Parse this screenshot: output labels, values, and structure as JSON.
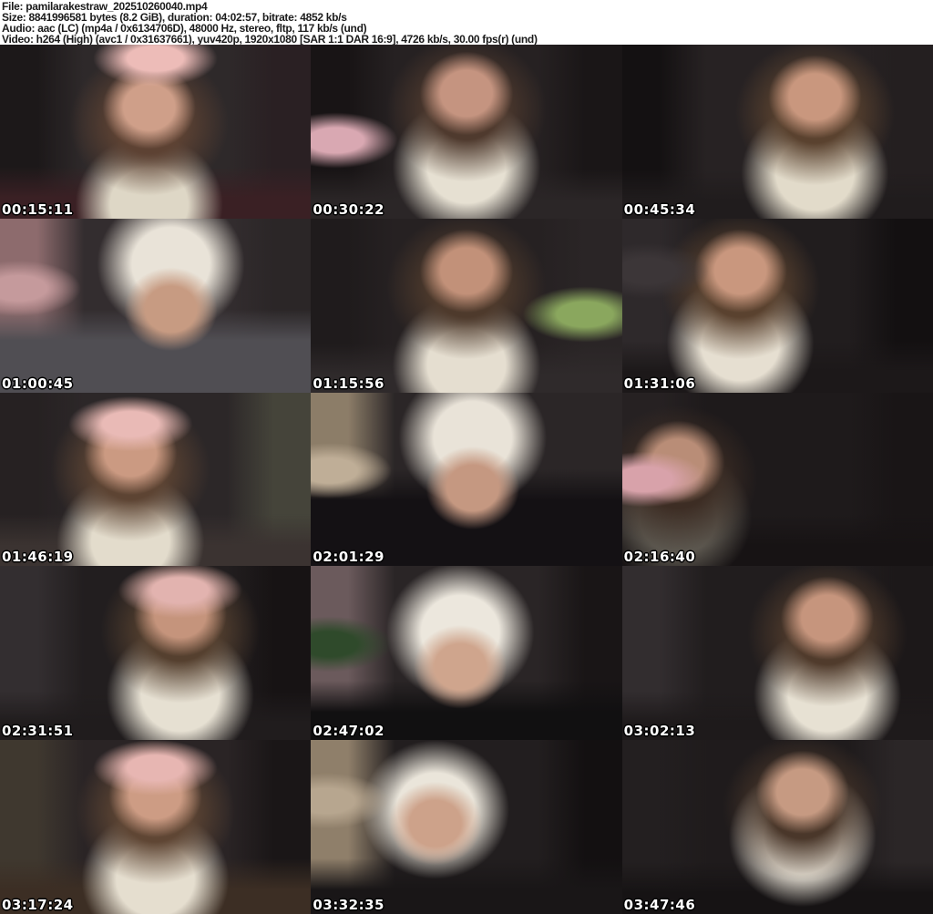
{
  "theme": {
    "header_background": "#ffffff",
    "header_text_color": "#1b1b1b",
    "timestamp_text_color": "#ffffff",
    "timestamp_outline_color": "#000000"
  },
  "header": {
    "lines": [
      "File: pamilarakestraw_202510260040.mp4",
      "Size: 8841996581 bytes (8.2 GiB), duration: 04:02:57, bitrate: 4852 kb/s",
      "Audio: aac (LC) (mp4a / 0x6134706D), 48000 Hz, stereo, fltp, 117 kb/s (und)",
      "Video: h264 (High) (avc1 / 0x31637661), yuv420p, 1920x1080 [SAR 1:1 DAR 16:9], 4726 kb/s, 30.00 fps(r) (und)"
    ]
  },
  "thumbnails": [
    {
      "timestamp": "00:15:11",
      "fx": "48%",
      "sy": "36%",
      "hair": "#5d4233",
      "skin": "#cf9f89",
      "top": "#ded7c6",
      "ty": "92%",
      "accent": "#edbcb8",
      "ax": "50%",
      "ay": "8%",
      "edgeL": "#1c1819",
      "edgeR": "#2a2023",
      "bottom": "#3a2024",
      "bh": "12%",
      "bg": "#2e292a"
    },
    {
      "timestamp": "00:30:22",
      "fx": "50%",
      "sy": "28%",
      "hair": "#4f3a2e",
      "skin": "#c59480",
      "top": "#e6e0d2",
      "ty": "70%",
      "accent": "#d9a8b2",
      "ax": "8%",
      "ay": "55%",
      "edgeL": "#181415",
      "edgeR": "#1a1617",
      "bottom": "#2b2627",
      "bh": "10%",
      "bg": "#262122"
    },
    {
      "timestamp": "00:45:34",
      "fx": "62%",
      "sy": "30%",
      "hair": "#5a422f",
      "skin": "#c9977e",
      "top": "#e2dbca",
      "ty": "74%",
      "accent": "transparent",
      "ax": "50%",
      "ay": "10%",
      "edgeL": "#141112",
      "edgeR": "#241f20",
      "bottom": "#201c1d",
      "bh": "10%",
      "bg": "#272223"
    },
    {
      "timestamp": "01:00:45",
      "fx": "55%",
      "sy": "52%",
      "hair": "transparent",
      "skin": "#c79b82",
      "top": "#e9e3d8",
      "ty": "26%",
      "accent": "#c59a9c",
      "ax": "6%",
      "ay": "40%",
      "edgeL": "#8d6b6d",
      "edgeR": "#2b2627",
      "bottom": "#504e53",
      "bh": "30%",
      "bg": "#332d2f"
    },
    {
      "timestamp": "01:15:56",
      "fx": "50%",
      "sy": "30%",
      "hair": "#4e3a2c",
      "skin": "#c29179",
      "top": "#e5ded0",
      "ty": "84%",
      "accent": "#8aa75e",
      "ax": "88%",
      "ay": "55%",
      "edgeL": "#1f1b1c",
      "edgeR": "#2a2526",
      "bottom": "#2f2a2b",
      "bh": "10%",
      "bg": "#262122"
    },
    {
      "timestamp": "01:31:06",
      "fx": "38%",
      "sy": "30%",
      "hair": "#5a422f",
      "skin": "#c9977e",
      "top": "#e6dfd1",
      "ty": "72%",
      "accent": "#3c3638",
      "ax": "8%",
      "ay": "30%",
      "edgeL": "#2e292b",
      "edgeR": "#131011",
      "bottom": "#1c1819",
      "bh": "12%",
      "bg": "#211d1e"
    },
    {
      "timestamp": "01:46:19",
      "fx": "42%",
      "sy": "35%",
      "hair": "#5d4433",
      "skin": "#cb9a82",
      "top": "#e3dccc",
      "ty": "86%",
      "accent": "#e9bab6",
      "ax": "42%",
      "ay": "18%",
      "edgeL": "#262122",
      "edgeR": "#45443a",
      "bottom": "#3b3331",
      "bh": "12%",
      "bg": "#2c2728"
    },
    {
      "timestamp": "02:01:29",
      "fx": "52%",
      "sy": "55%",
      "hair": "transparent",
      "skin": "#c59881",
      "top": "#e9e3d8",
      "ty": "26%",
      "accent": "#bfae97",
      "ax": "6%",
      "ay": "45%",
      "edgeL": "#8c7d68",
      "edgeR": "#2b2627",
      "bottom": "#141114",
      "bh": "38%",
      "bg": "#2b2627"
    },
    {
      "timestamp": "02:16:40",
      "fx": "18%",
      "sy": "40%",
      "hair": "#3d2d24",
      "skin": "#b98d77",
      "top": "#5b564e",
      "ty": "72%",
      "accent": "#d8a2aa",
      "ax": "7%",
      "ay": "50%",
      "edgeL": "#262122",
      "edgeR": "#191516",
      "bottom": "#171314",
      "bh": "12%",
      "bg": "#1e1a1b"
    },
    {
      "timestamp": "02:31:51",
      "fx": "58%",
      "sy": "28%",
      "hair": "#55402f",
      "skin": "#c5947c",
      "top": "#e6e0d2",
      "ty": "74%",
      "accent": "#e2b3af",
      "ax": "58%",
      "ay": "14%",
      "edgeL": "#332e30",
      "edgeR": "#171314",
      "bottom": "#201c1d",
      "bh": "10%",
      "bg": "#221e1f"
    },
    {
      "timestamp": "02:47:02",
      "fx": "48%",
      "sy": "58%",
      "hair": "transparent",
      "skin": "#cfa58d",
      "top": "#ece7dd",
      "ty": "38%",
      "accent": "#2f4a2b",
      "ax": "6%",
      "ay": "45%",
      "edgeL": "#6b5a5c",
      "edgeR": "#191516",
      "bottom": "#111011",
      "bh": "16%",
      "bg": "#2a2526"
    },
    {
      "timestamp": "03:02:13",
      "fx": "66%",
      "sy": "30%",
      "hair": "#503b2c",
      "skin": "#c6957d",
      "top": "#e7e1d3",
      "ty": "74%",
      "accent": "transparent",
      "ax": "50%",
      "ay": "10%",
      "edgeL": "#322d2f",
      "edgeR": "#1c1819",
      "bottom": "#1e1a1b",
      "bh": "10%",
      "bg": "#211d1e"
    },
    {
      "timestamp": "03:17:24",
      "fx": "50%",
      "sy": "32%",
      "hair": "#5f4634",
      "skin": "#cd9c84",
      "top": "#e5decf",
      "ty": "80%",
      "accent": "#e7b6b2",
      "ax": "50%",
      "ay": "16%",
      "edgeL": "#3f382f",
      "edgeR": "#1a1617",
      "bottom": "#3c2e24",
      "bh": "14%",
      "bg": "#2a2425"
    },
    {
      "timestamp": "03:32:35",
      "fx": "40%",
      "sy": "48%",
      "hair": "transparent",
      "skin": "#cda28a",
      "top": "#eae5da",
      "ty": "40%",
      "accent": "#b7a68f",
      "ax": "5%",
      "ay": "35%",
      "edgeL": "#8f7f6a",
      "edgeR": "#131011",
      "bottom": "#191617",
      "bh": "14%",
      "bg": "#221e1f"
    },
    {
      "timestamp": "03:47:46",
      "fx": "58%",
      "sy": "30%",
      "hair": "#4a372a",
      "skin": "#c69a82",
      "top": "#e8e2d6",
      "ty": "56%",
      "accent": "transparent",
      "ax": "50%",
      "ay": "10%",
      "edgeL": "#231f20",
      "edgeR": "#2b2627",
      "bottom": "#161314",
      "bh": "12%",
      "bg": "#1f1b1c"
    }
  ]
}
